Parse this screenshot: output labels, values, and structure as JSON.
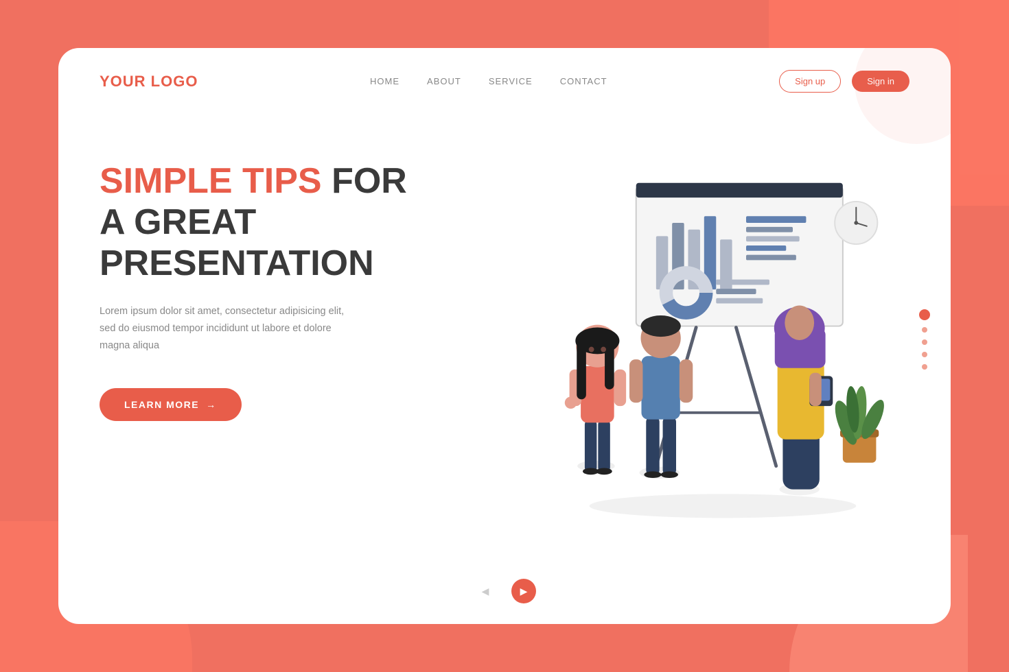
{
  "brand": {
    "logo": "YOUR LOGO"
  },
  "nav": {
    "links": [
      "HOME",
      "ABOUT",
      "SERVICE",
      "CONTACT"
    ],
    "signup": "Sign up",
    "signin": "Sign in"
  },
  "hero": {
    "headline_colored": "SIMPLE TIPS",
    "headline_dark1": " FOR",
    "headline_dark2": "A GREAT",
    "headline_dark3": "PRESENTATION",
    "description": "Lorem ipsum dolor sit amet, consectetur adipisicing elit, sed do eiusmod tempor incididunt ut labore et dolore magna aliqua",
    "cta_label": "LEARN MORE"
  }
}
